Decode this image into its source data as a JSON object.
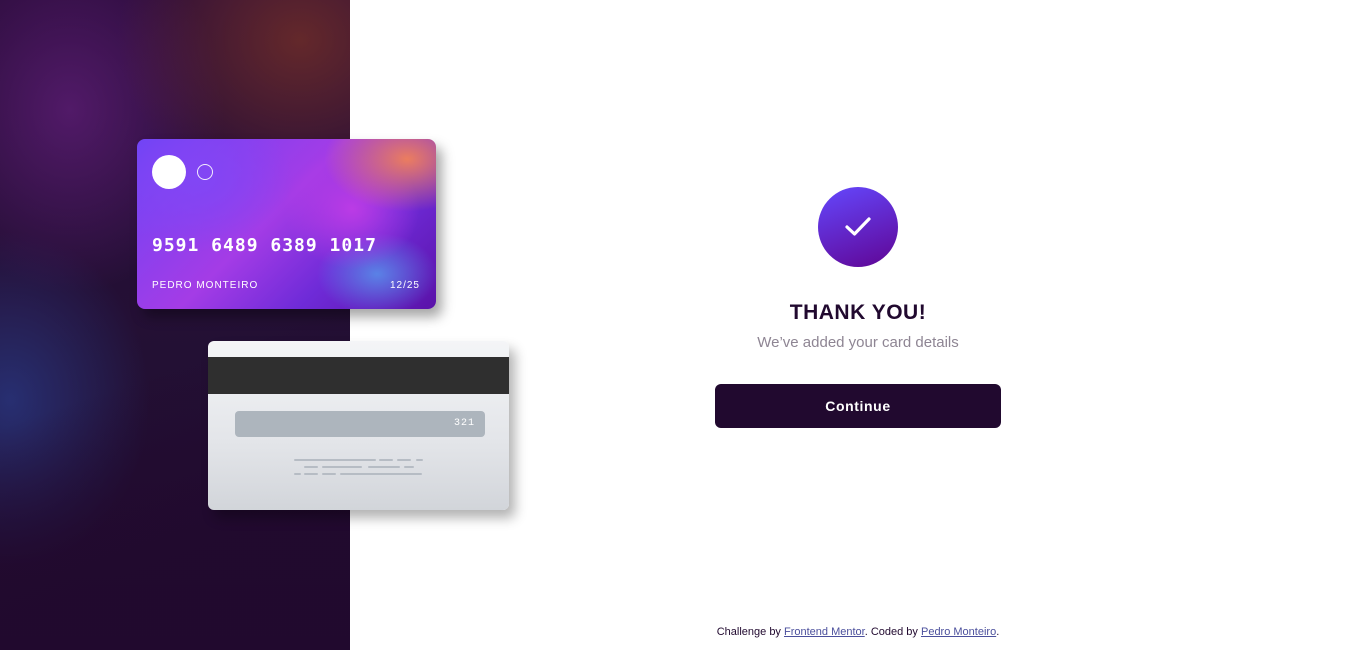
{
  "card_front": {
    "number": "9591 6489 6389 1017",
    "name": "PEDRO MONTEIRO",
    "expiry": "12/25"
  },
  "card_back": {
    "cvc": "321"
  },
  "complete": {
    "icon": "check-icon",
    "title": "THANK YOU!",
    "message": "We’ve added your card details",
    "button_label": "Continue"
  },
  "attribution": {
    "prefix": "Challenge by ",
    "link1": "Frontend Mentor",
    "middle": ". Coded by ",
    "link2": "Pedro Monteiro",
    "suffix": "."
  },
  "colors": {
    "dark_violet": "#21092f",
    "grayish_violet": "#8e8593",
    "accent_start": "#6448fe",
    "accent_end": "#600594"
  }
}
